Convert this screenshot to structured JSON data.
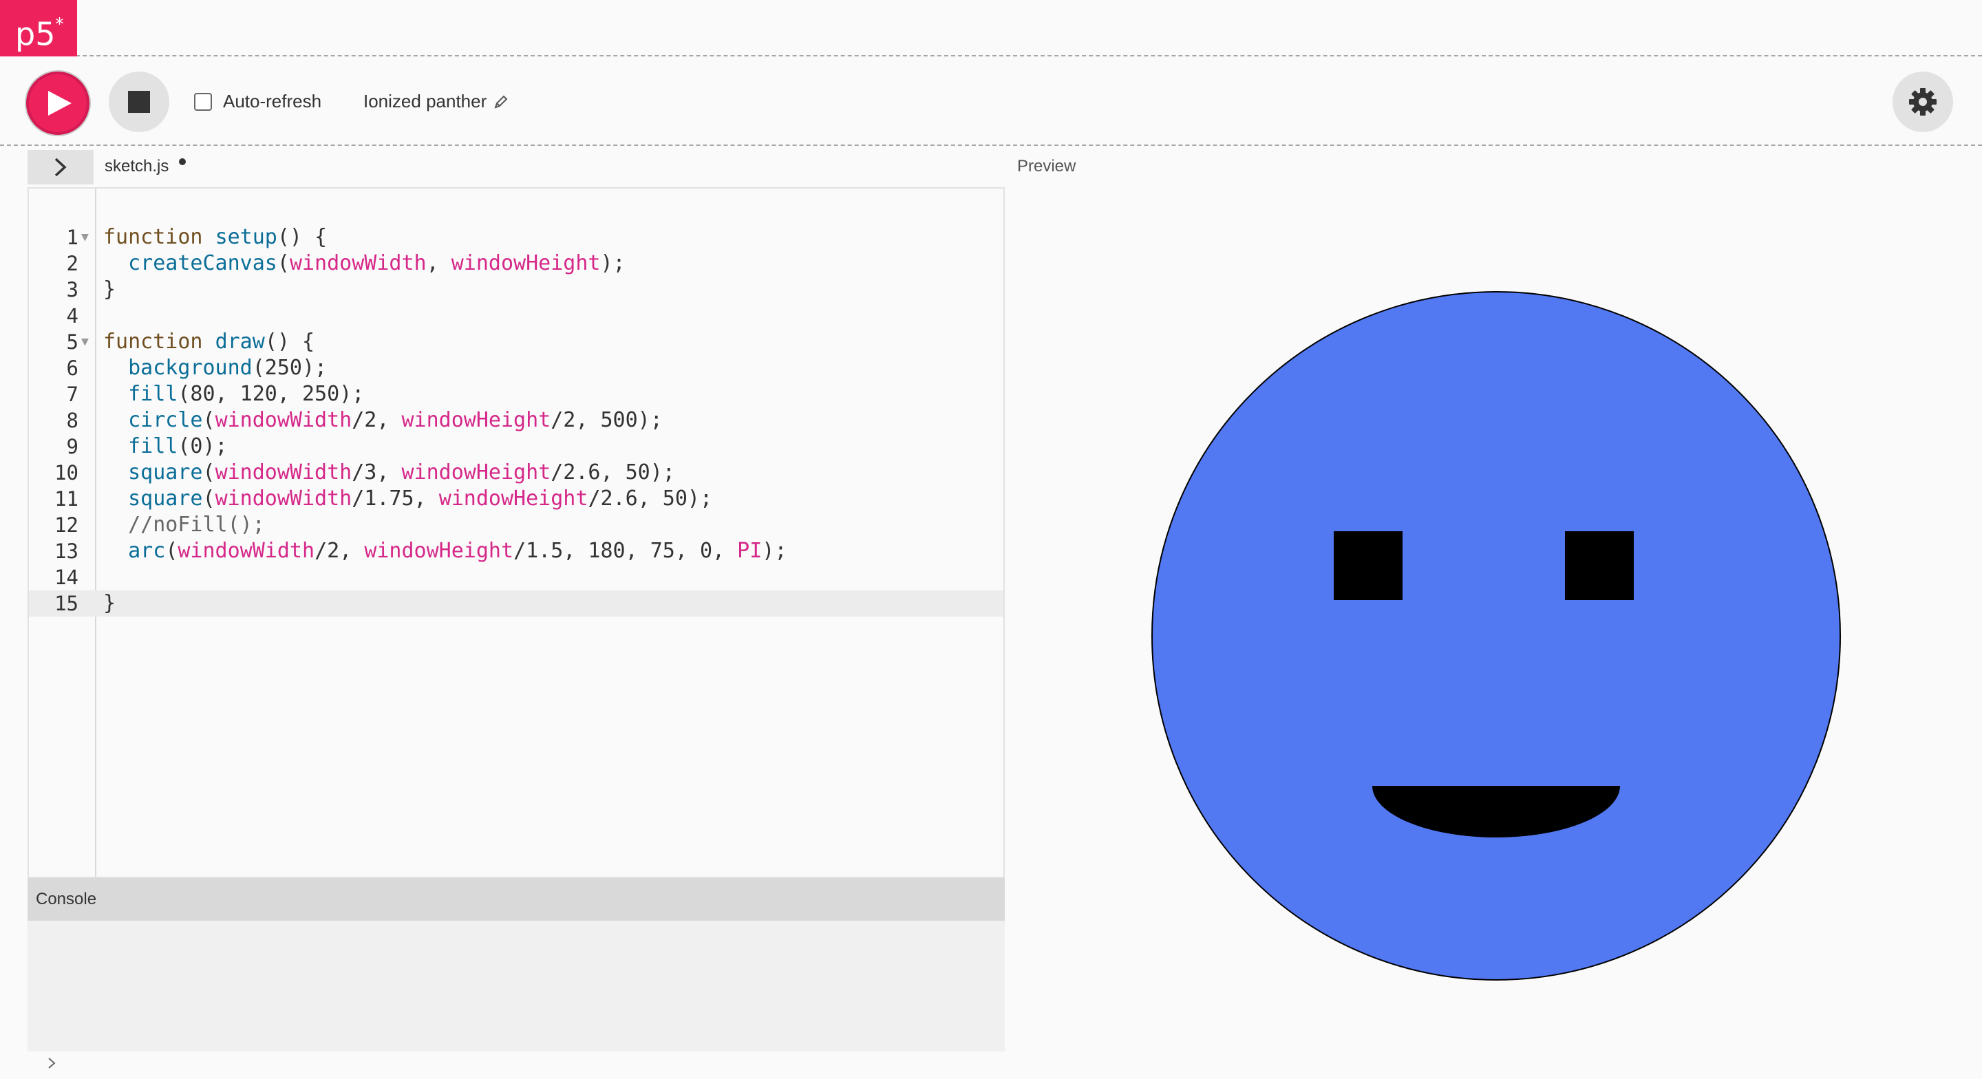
{
  "app": {
    "logo_text": "p5",
    "logo_superscript": "*",
    "brand_color": "#ed225d"
  },
  "toolbar": {
    "play_icon": "play-icon",
    "stop_icon": "stop-icon",
    "auto_refresh_label": "Auto-refresh",
    "auto_refresh_checked": false,
    "project_name": "Ionized panther",
    "edit_icon": "pencil-icon",
    "settings_icon": "gear-icon"
  },
  "editor": {
    "file_name": "sketch.js",
    "unsaved": true,
    "active_line": 15,
    "lines": [
      {
        "n": "1",
        "fold": true,
        "text": "function setup() {"
      },
      {
        "n": "2",
        "fold": false,
        "text": "  createCanvas(windowWidth, windowHeight);"
      },
      {
        "n": "3",
        "fold": false,
        "text": "}"
      },
      {
        "n": "4",
        "fold": false,
        "text": ""
      },
      {
        "n": "5",
        "fold": true,
        "text": "function draw() {"
      },
      {
        "n": "6",
        "fold": false,
        "text": "  background(250);"
      },
      {
        "n": "7",
        "fold": false,
        "text": "  fill(80, 120, 250);"
      },
      {
        "n": "8",
        "fold": false,
        "text": "  circle(windowWidth/2, windowHeight/2, 500);"
      },
      {
        "n": "9",
        "fold": false,
        "text": "  fill(0);"
      },
      {
        "n": "10",
        "fold": false,
        "text": "  square(windowWidth/3, windowHeight/2.6, 50);"
      },
      {
        "n": "11",
        "fold": false,
        "text": "  square(windowWidth/1.75, windowHeight/2.6, 50);"
      },
      {
        "n": "12",
        "fold": false,
        "text": "  //noFill();"
      },
      {
        "n": "13",
        "fold": false,
        "text": "  arc(windowWidth/2, windowHeight/1.5, 180, 75, 0, PI);"
      },
      {
        "n": "14",
        "fold": false,
        "text": ""
      },
      {
        "n": "15",
        "fold": false,
        "text": "}"
      }
    ]
  },
  "preview": {
    "label": "Preview",
    "face_fill": "#5379f2",
    "feature_fill": "#000000",
    "background": "#fafafa"
  },
  "console": {
    "label": "Console",
    "prompt_icon": "chevron-right-icon"
  }
}
